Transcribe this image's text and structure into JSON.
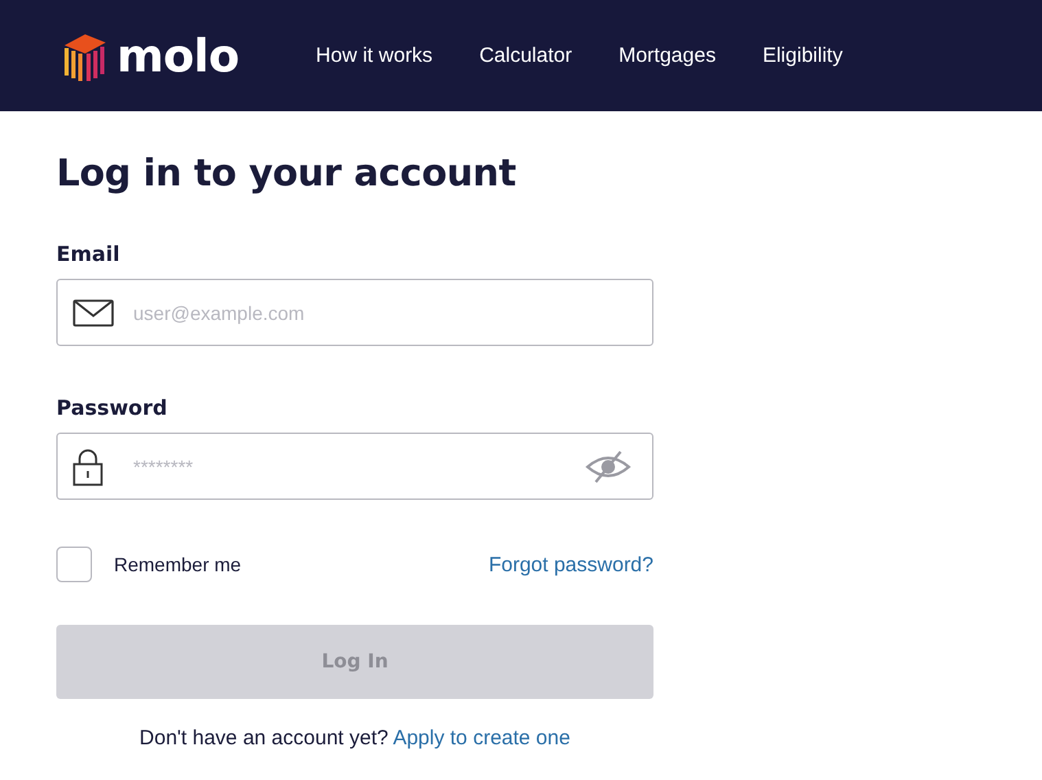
{
  "header": {
    "logo": "molo",
    "nav": [
      {
        "label": "How it works"
      },
      {
        "label": "Calculator"
      },
      {
        "label": "Mortgages"
      },
      {
        "label": "Eligibility"
      }
    ]
  },
  "title": "Log in to your account",
  "email": {
    "label": "Email",
    "placeholder": "user@example.com"
  },
  "password": {
    "label": "Password",
    "placeholder": "********",
    "revealed": false
  },
  "remember": {
    "label": "Remember me",
    "checked": false
  },
  "forgot": "Forgot password?",
  "login": {
    "label": "Log In",
    "disabled": true
  },
  "signup": {
    "text": "Don't have an account yet?",
    "link": "Apply to create one"
  }
}
